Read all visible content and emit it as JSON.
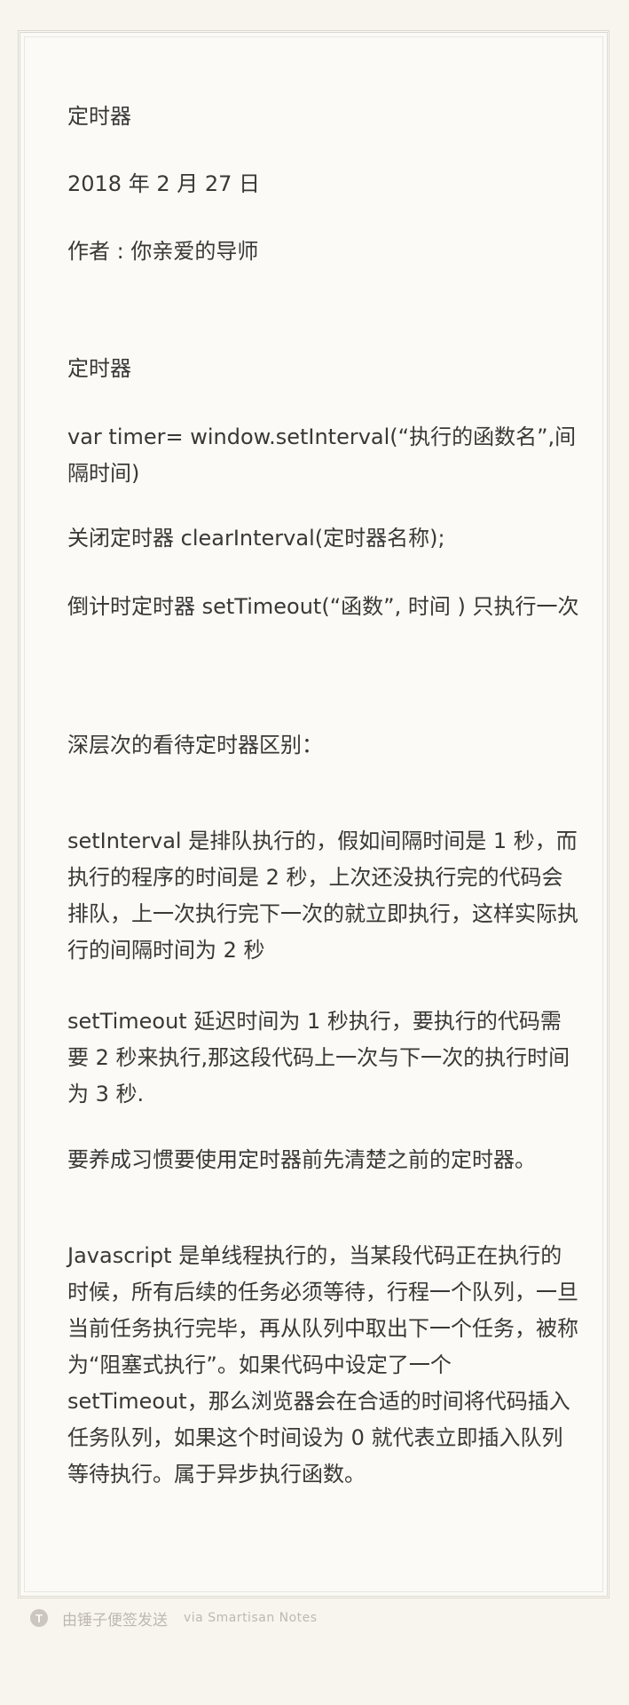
{
  "note": {
    "header": {
      "title": "定时器",
      "date": "2018 年 2 月 27 日",
      "author": "作者 : 你亲爱的导师"
    },
    "paragraphs": [
      "定时器",
      "var timer= window.setInterval(“执行的函数名”,间隔时间)",
      "关闭定时器 clearInterval(定时器名称);",
      "倒计时定时器 setTimeout(“函数”, 时间 ) 只执行一次",
      "深层次的看待定时器区别：",
      "setInterval 是排队执行的，假如间隔时间是 1 秒，而执行的程序的时间是 2 秒，上次还没执行完的代码会排队，上一次执行完下一次的就立即执行，这样实际执行的间隔时间为 2 秒",
      "setTimeout 延迟时间为 1 秒执行，要执行的代码需要 2 秒来执行,那这段代码上一次与下一次的执行时间为 3 秒.",
      "要养成习惯要使用定时器前先清楚之前的定时器。",
      "Javascript 是单线程执行的，当某段代码正在执行的时候，所有后续的任务必须等待，行程一个队列，一旦当前任务执行完毕，再从队列中取出下一个任务，被称为“阻塞式执行”。如果代码中设定了一个 setTimeout，那么浏览器会在合适的时间将代码插入任务队列，如果这个时间设为 0 就代表立即插入队列等待执行。属于异步执行函数。"
    ]
  },
  "footer": {
    "icon": "smartisan-t-icon",
    "icon_glyph": "T",
    "sent_by": "由锤子便签发送",
    "via": "via Smartisan Notes"
  }
}
